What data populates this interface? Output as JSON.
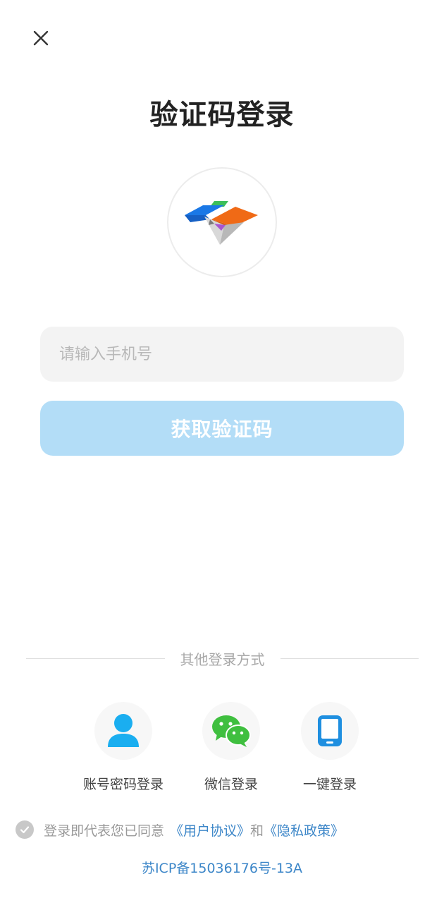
{
  "page": {
    "title": "验证码登录"
  },
  "form": {
    "phone_placeholder": "请输入手机号",
    "phone_value": "",
    "get_code_label": "获取验证码"
  },
  "other_login": {
    "divider_label": "其他登录方式",
    "options": [
      {
        "label": "账号密码登录",
        "icon": "user-icon",
        "color": "#1aaef0"
      },
      {
        "label": "微信登录",
        "icon": "wechat-icon",
        "color": "#3fbf3f"
      },
      {
        "label": "一键登录",
        "icon": "phone-icon",
        "color": "#1f8fe0"
      }
    ]
  },
  "agreement": {
    "prefix": "登录即代表您已同意",
    "user_agreement": "《用户协议》",
    "and": "和",
    "privacy_policy": "《隐私政策》",
    "checked": false
  },
  "footer": {
    "icp": "苏ICP备15036176号-13A"
  },
  "colors": {
    "primary_disabled": "#b3ddf7",
    "link": "#3c86c8",
    "input_bg": "#f3f3f3"
  }
}
